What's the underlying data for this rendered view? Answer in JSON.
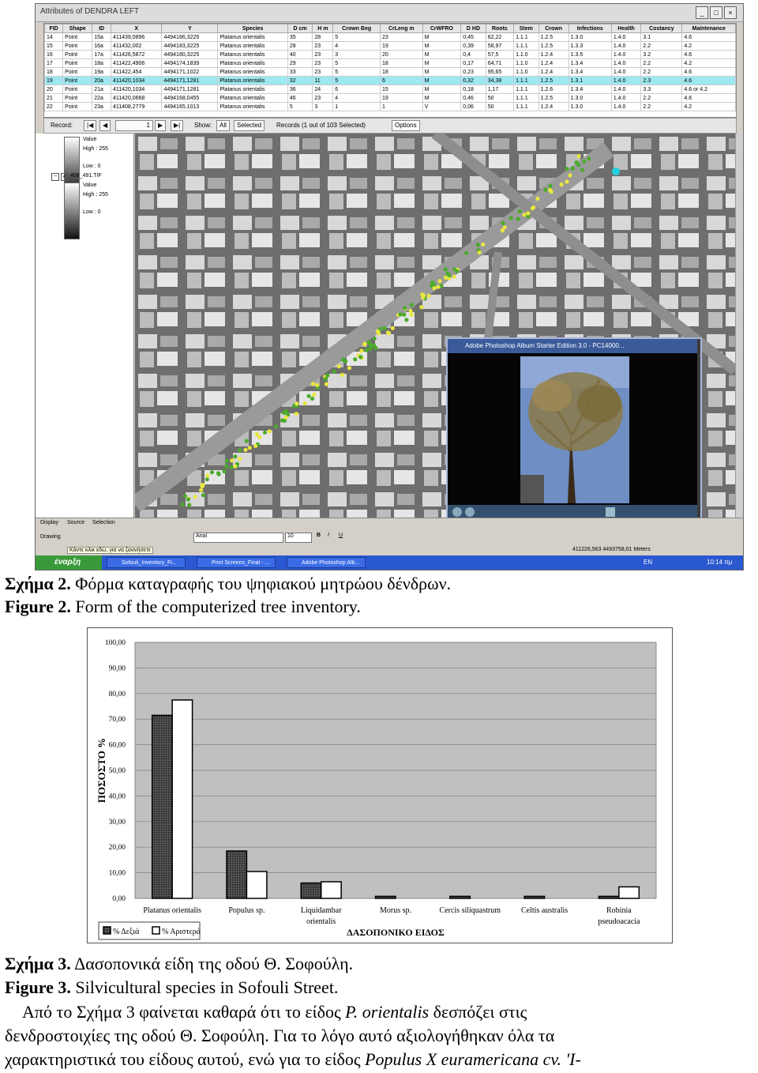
{
  "screenshot": {
    "window_title": "Attributes of DENDRA LEFT",
    "table": {
      "headers": [
        "FID",
        "Shape",
        "ID",
        "X",
        "Y",
        "Species",
        "D cm",
        "H m",
        "Crown Beg",
        "CrLeng m",
        "CrWFRO",
        "D HD",
        "Roots",
        "Stem",
        "Crown",
        "Infections",
        "Health",
        "Costancy",
        "Maintenance"
      ],
      "rows": [
        [
          "14",
          "Point",
          "15a",
          "411439,0896",
          "4494186,3225",
          "Platanus orientalis",
          "35",
          "28",
          "5",
          "23",
          "M",
          "0,45",
          "62,22",
          "1.1.1",
          "1.2.5",
          "1.3.0",
          "1.4.0",
          "3.1",
          "4.6"
        ],
        [
          "15",
          "Point",
          "16a",
          "411432,002",
          "4494183,3225",
          "Platanus orientalis",
          "28",
          "23",
          "4",
          "19",
          "M",
          "0,39",
          "58,97",
          "1.1.1",
          "1.2.5",
          "1.3.3",
          "1.4.0",
          "2.2",
          "4.2"
        ],
        [
          "16",
          "Point",
          "17a",
          "411426,5872",
          "4494180,3225",
          "Platanus orientalis",
          "40",
          "23",
          "3",
          "20",
          "M",
          "0,4",
          "57,5",
          "1.1.0",
          "1.2.4",
          "1.3.5",
          "1.4.0",
          "3.2",
          "4.6"
        ],
        [
          "17",
          "Point",
          "18a",
          "411422,4906",
          "4494174,1839",
          "Platanus orientalis",
          "29",
          "23",
          "5",
          "18",
          "M",
          "0,17",
          "64,71",
          "1.1.0",
          "1.2.4",
          "1.3.4",
          "1.4.0",
          "2.2",
          "4.2"
        ],
        [
          "18",
          "Point",
          "19a",
          "411422,454",
          "4494171,1022",
          "Platanus orientalis",
          "33",
          "23",
          "5",
          "18",
          "M",
          "0,23",
          "95,65",
          "1.1.0",
          "1.2.4",
          "1.3.4",
          "1.4.0",
          "2.2",
          "4.6"
        ],
        [
          "19",
          "Point",
          "20a",
          "411420,1034",
          "4494171,1281",
          "Platanus orientalis",
          "32",
          "11",
          "5",
          "6",
          "M",
          "0,32",
          "34,38",
          "1.1.1",
          "1.2.5",
          "1.3.1",
          "1.4.0",
          "2.3",
          "4.6"
        ],
        [
          "20",
          "Point",
          "21a",
          "411420,1034",
          "4494171,1281",
          "Platanus orientalis",
          "36",
          "24",
          "6",
          "15",
          "M",
          "0,18",
          "1,17",
          "1.1.1",
          "1.2.6",
          "1.3.4",
          "1.4.0",
          "3.3",
          "4.6 or 4.2"
        ],
        [
          "21",
          "Point",
          "22a",
          "411420,0668",
          "4494168,0455",
          "Platanus orientalis",
          "46",
          "23",
          "4",
          "19",
          "M",
          "0,46",
          "50",
          "1.1.1",
          "1.2.5",
          "1.3.0",
          "1.4.0",
          "2.2",
          "4.6"
        ],
        [
          "22",
          "Point",
          "23a",
          "411408,2779",
          "4494165,1013",
          "Platanus orientalis",
          "5",
          "3",
          "1",
          "1",
          "V",
          "0,06",
          "50",
          "1.1.1",
          "1.2.4",
          "1.3.0",
          "1.4.0",
          "2.2",
          "4.2"
        ]
      ],
      "selected_row": 5
    },
    "record_bar": {
      "record_label": "Record:",
      "record_value": "1",
      "show_label": "Show:",
      "all_label": "All",
      "selected_label": "Selected",
      "records_text": "Records (1 out of 103 Selected)",
      "options_label": "Options"
    },
    "legend_panel": {
      "value_label_1": "Value",
      "high_1": "High : 255",
      "low_1": "Low : 0",
      "layer_name": "408_491.TIF",
      "value_label_2": "Value",
      "high_2": "High : 255",
      "low_2": "Low : 0"
    },
    "photo_window": {
      "title": "Adobe Photoshop Album Starter Edition 3.0 - PC14000..."
    },
    "bottom_tabs": [
      "Display",
      "Source",
      "Selection"
    ],
    "drawing_label": "Drawing",
    "font_name": "Arial",
    "font_size": "10",
    "status_hint": "Κάντε κλικ εδώ, για να ξεκινήσετε",
    "coordinates": "411226,563  4493758,01 Meters",
    "taskbar": {
      "start": "έναρξη",
      "items": [
        "Sofouli_Inventory_Fi...",
        "Print Screens_Final - ...",
        "Adobe Photoshop Alb..."
      ],
      "lang": "EN",
      "time": "10:14 πμ"
    }
  },
  "captions": {
    "fig2_gr_label": "Σχήμα 2.",
    "fig2_gr_text": "Φόρμα καταγραφής του ψηφιακού μητρώου δένδρων.",
    "fig2_en_label": "Figure 2.",
    "fig2_en_text": "Form of the computerized tree inventory.",
    "fig3_gr_label": "Σχήμα 3.",
    "fig3_gr_text": "Δασοπονικά είδη της οδού Θ. Σοφούλη.",
    "fig3_en_label": "Figure 3.",
    "fig3_en_text": "Silvicultural species in Sofouli Street."
  },
  "paragraph": {
    "line1_a": "Από το Σχήμα 3 φαίνεται καθαρά ότι το είδος ",
    "line1_i": "P. orientalis",
    "line1_b": " δεσπόζει στις",
    "line2": "δενδροστοιχίες της οδού Θ. Σοφούλη. Για το λόγο αυτό αξιολογήθηκαν όλα τα",
    "line3_a": "χαρακτηριστικά του είδους αυτού, ενώ για το είδος ",
    "line3_i": "Populus X euramericana cv. 'I-"
  },
  "chart_data": {
    "type": "bar",
    "categories": [
      "Platanus orientalis",
      "Populus sp.",
      "Liquidambar orientalis",
      "Morus sp.",
      "Cercis siliquastrum",
      "Celtis australis",
      "Robinia pseudoacacia"
    ],
    "series": [
      {
        "name": "% Δεξιά",
        "values": [
          71.5,
          18.5,
          6.0,
          0.8,
          0.8,
          0.8,
          0.8
        ]
      },
      {
        "name": "% Αριστερά",
        "values": [
          77.5,
          10.5,
          6.5,
          0,
          0,
          0,
          4.5
        ]
      }
    ],
    "ylabel": "ΠΟΣΟΣΤΟ %",
    "xlabel": "ΔΑΣΟΠΟΝΙΚΟ ΕΙΔΟΣ",
    "yticks": [
      "0,00",
      "10,00",
      "20,00",
      "30,00",
      "40,00",
      "50,00",
      "60,00",
      "70,00",
      "80,00",
      "90,00",
      "100,00"
    ],
    "ylim": [
      0,
      100
    ],
    "grid": true,
    "legend_position": "bottom-left",
    "colors": {
      "plot_bg": "#c0c0c0",
      "series1": "#333333",
      "series2": "#ffffff"
    }
  }
}
